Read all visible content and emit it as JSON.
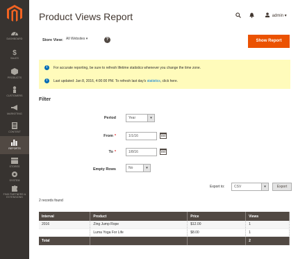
{
  "sidebar": {
    "items": [
      {
        "label": "Dashboard",
        "icon": "dashboard-icon"
      },
      {
        "label": "Sales",
        "icon": "dollar-icon"
      },
      {
        "label": "Products",
        "icon": "cube-icon"
      },
      {
        "label": "Customers",
        "icon": "person-icon"
      },
      {
        "label": "Marketing",
        "icon": "megaphone-icon"
      },
      {
        "label": "Content",
        "icon": "layout-icon"
      },
      {
        "label": "Reports",
        "icon": "bar-chart-icon"
      },
      {
        "label": "Stores",
        "icon": "store-icon"
      },
      {
        "label": "System",
        "icon": "gear-icon"
      },
      {
        "label": "Find Partners & Extensions",
        "icon": "puzzle-icon"
      }
    ],
    "active_index": 6
  },
  "header": {
    "title": "Product Views Report",
    "user": "admin ▾"
  },
  "store_view": {
    "label": "Store View:",
    "value": "All Websites ▾"
  },
  "show_report_label": "Show Report",
  "messages": [
    {
      "text": "For accurate reporting, be sure to refresh lifetime statistics whenever you change the time zone."
    },
    {
      "text": "Last updated: Jan 8, 2016, 4:00:00 PM. To refresh last day's ",
      "link": "statistics",
      "after": ", click here."
    }
  ],
  "filter": {
    "title": "Filter",
    "period_label": "Period",
    "period_value": "Year",
    "from_label": "From",
    "from_value": "1/1/16",
    "to_label": "To",
    "to_value": "1/8/16",
    "empty_rows_label": "Empty Rows",
    "empty_rows_value": "No"
  },
  "export": {
    "label": "Export to:",
    "format": "CSV",
    "button": "Export"
  },
  "records_found": "2 records found",
  "table": {
    "headers": [
      "Interval",
      "Product",
      "Price",
      "Views"
    ],
    "rows": [
      [
        "2016",
        "Zing Jump Rope",
        "$12.00",
        "1"
      ],
      [
        "",
        "Luma Yoga For Life",
        "$8.00",
        "1"
      ]
    ],
    "total": [
      "Total",
      "",
      "",
      "2"
    ]
  },
  "colors": {
    "sidebar": "#373330",
    "accent": "#eb5202",
    "notice": "#fffbbb",
    "table_header": "#514943"
  }
}
